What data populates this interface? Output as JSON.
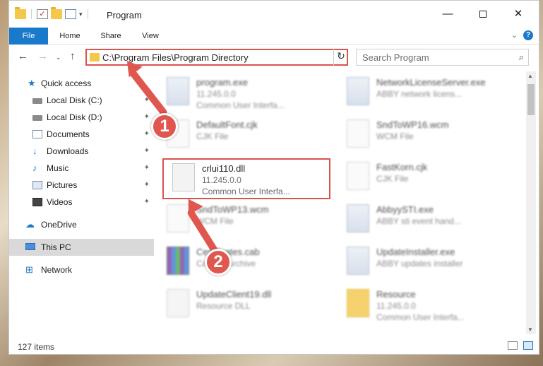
{
  "window": {
    "title": "Program",
    "minimize": "—",
    "maximize": "",
    "close": "✕"
  },
  "ribbon": {
    "tabs": [
      "File",
      "Home",
      "Share",
      "View"
    ],
    "expand": "⌄",
    "help": "?"
  },
  "nav": {
    "back": "←",
    "forward": "→",
    "recent": "⌄",
    "up": "↑",
    "address": "C:\\Program Files\\Program Directory",
    "address_dropdown": "⌄",
    "refresh": "↻",
    "search_placeholder": "Search Program",
    "search_icon": "⌕"
  },
  "sidebar": {
    "items": [
      {
        "label": "Quick access",
        "icon": "star-icon",
        "pinned": false
      },
      {
        "label": "Local Disk (C:)",
        "icon": "drive-icon",
        "pinned": true
      },
      {
        "label": "Local Disk (D:)",
        "icon": "drive-icon",
        "pinned": true
      },
      {
        "label": "Documents",
        "icon": "documents-icon",
        "pinned": true
      },
      {
        "label": "Downloads",
        "icon": "download-icon",
        "pinned": true
      },
      {
        "label": "Music",
        "icon": "music-icon",
        "pinned": true
      },
      {
        "label": "Pictures",
        "icon": "pictures-icon",
        "pinned": true
      },
      {
        "label": "Videos",
        "icon": "videos-icon",
        "pinned": true
      },
      {
        "label": "OneDrive",
        "icon": "cloud-icon",
        "pinned": false
      },
      {
        "label": "This PC",
        "icon": "computer-icon",
        "pinned": false,
        "selected": true
      },
      {
        "label": "Network",
        "icon": "network-icon",
        "pinned": false
      }
    ],
    "pin_glyph": "📌"
  },
  "files": [
    {
      "name": "program.exe",
      "line2": "11.245.0.0",
      "line3": "Common User Interfa...",
      "icon": "app"
    },
    {
      "name": "NetworkLicenseServer.exe",
      "line2": "ABBY network licens...",
      "line3": "",
      "icon": "app"
    },
    {
      "name": "DefaultFont.cjk",
      "line2": "CJK File",
      "line3": "",
      "icon": "file"
    },
    {
      "name": "SndToWP16.wcm",
      "line2": "WCM File",
      "line3": "",
      "icon": "file"
    },
    {
      "name": "crlui110.dll",
      "line2": "11.245.0.0",
      "line3": "Common User Interfa...",
      "icon": "dll",
      "highlighted": true
    },
    {
      "name": "FastKorn.cjk",
      "line2": "CJK File",
      "line3": "",
      "icon": "file"
    },
    {
      "name": "SndToWP13.wcm",
      "line2": "WCM File",
      "line3": "",
      "icon": "file"
    },
    {
      "name": "AbbyySTI.exe",
      "line2": "ABBY sti event hand...",
      "line3": "",
      "icon": "app"
    },
    {
      "name": "Certificates.cab",
      "line2": "Cabinet Archive",
      "line3": "",
      "icon": "zip"
    },
    {
      "name": "UpdateInstaller.exe",
      "line2": "ABBY updates installer",
      "line3": "",
      "icon": "app"
    },
    {
      "name": "UpdateClient19.dll",
      "line2": "Resource DLL",
      "line3": "",
      "icon": "dll"
    },
    {
      "name": "Resource",
      "line2": "11.245.0.0",
      "line3": "Common User Interfa...",
      "icon": "folder"
    }
  ],
  "annotations": {
    "step1": "1",
    "step2": "2"
  },
  "status": {
    "item_count": "127 items"
  },
  "colors": {
    "accent": "#1979ca",
    "highlight": "#d9534f",
    "annotation": "#e0574f"
  }
}
